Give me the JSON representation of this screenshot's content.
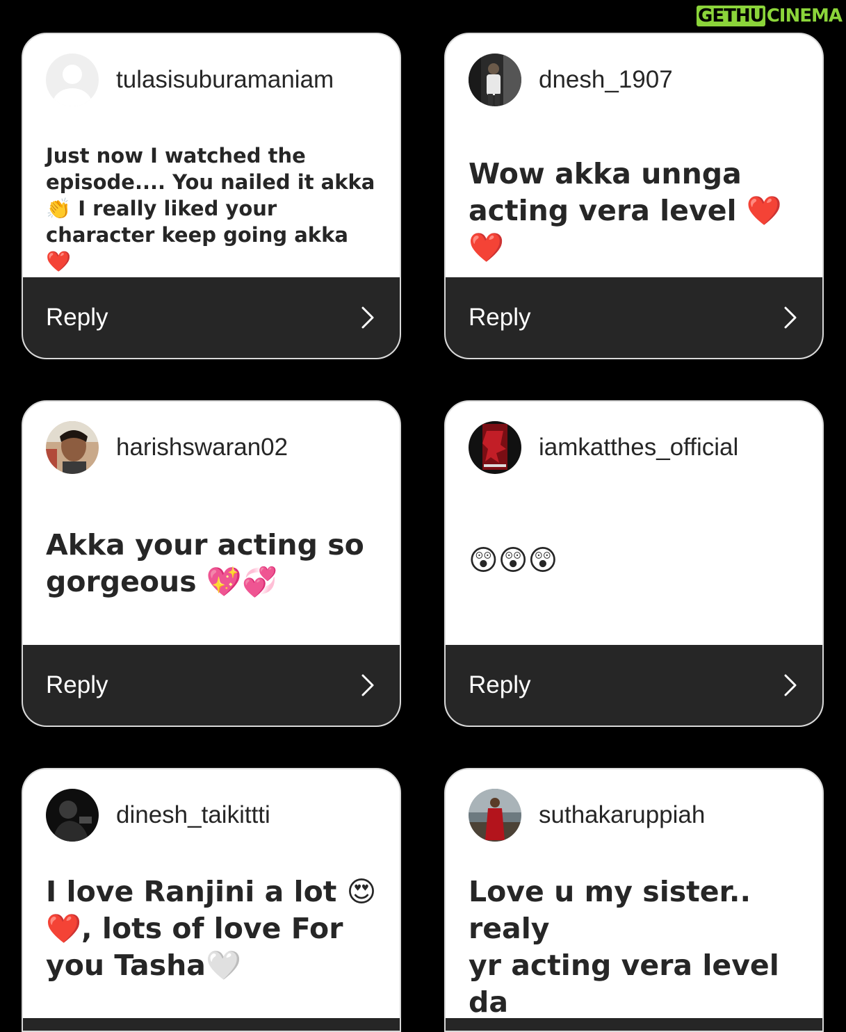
{
  "watermark": {
    "part1": "GETHU",
    "part2": "CINEMA"
  },
  "reply_label": "Reply",
  "cards": [
    {
      "username": "tulasisuburamaniam",
      "comment_lines": [
        "Just now I watched the",
        "episode.... You nailed it akka",
        "👏 I really liked your",
        "character keep going akka ❤️"
      ]
    },
    {
      "username": "dnesh_1907",
      "comment_lines": [
        "Wow akka unnga",
        "acting vera level ❤️❤️"
      ]
    },
    {
      "username": "harishswaran02",
      "comment_lines": [
        "Akka your acting so",
        "gorgeous 💖💞"
      ]
    },
    {
      "username": "iamkatthes_official",
      "comment_lines": [
        "😲😲😲"
      ]
    },
    {
      "username": "dinesh_taikittti",
      "comment_lines": [
        "I love Ranjini a lot 😍",
        "❤️, lots of love For",
        "you Tasha🤍"
      ]
    },
    {
      "username": "suthakaruppiah",
      "comment_lines": [
        "Love u my sister.. realy",
        "yr acting vera level da",
        "👏🏼"
      ]
    }
  ],
  "colors": {
    "background": "#000000",
    "card": "#ffffff",
    "reply_bar": "#262626",
    "text": "#262626",
    "watermark": "#8bd43a"
  }
}
